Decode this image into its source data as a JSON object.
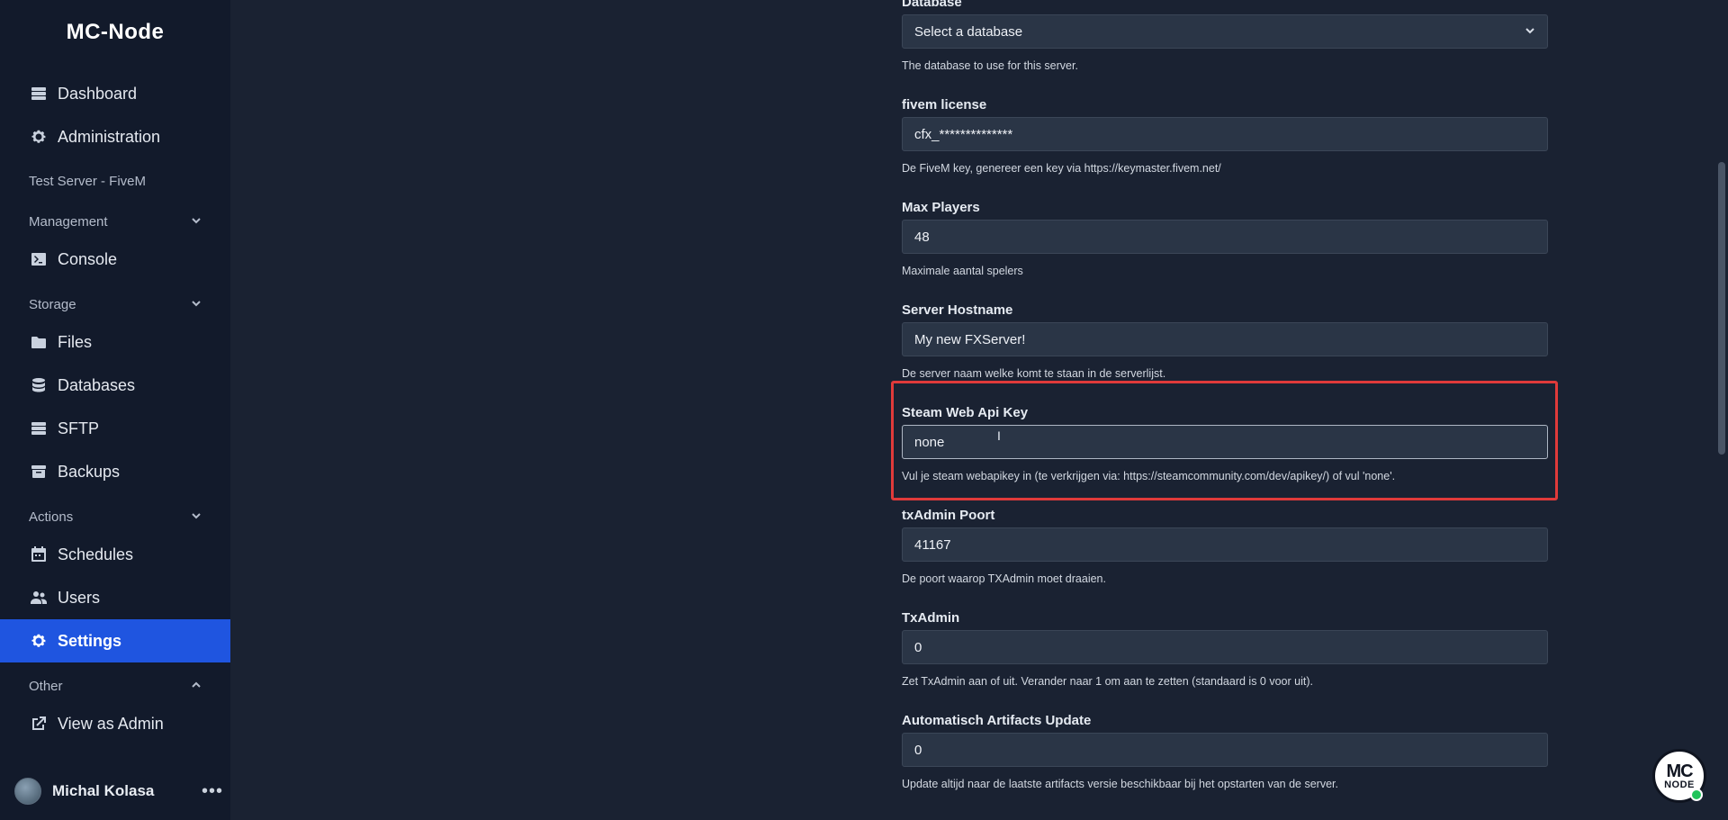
{
  "app": {
    "brand": "MC-Node"
  },
  "sidebar": {
    "top_items": [
      {
        "label": "Dashboard",
        "icon": "server-stack-icon"
      },
      {
        "label": "Administration",
        "icon": "gear-icon"
      }
    ],
    "server_name": "Test Server - FiveM",
    "sections": {
      "management": {
        "label": "Management"
      },
      "storage": {
        "label": "Storage"
      },
      "actions": {
        "label": "Actions"
      },
      "other": {
        "label": "Other"
      }
    },
    "items": {
      "console": {
        "label": "Console",
        "icon": "terminal-icon"
      },
      "files": {
        "label": "Files",
        "icon": "folder-icon"
      },
      "databases": {
        "label": "Databases",
        "icon": "database-icon"
      },
      "sftp": {
        "label": "SFTP",
        "icon": "server-stack-icon"
      },
      "backups": {
        "label": "Backups",
        "icon": "archive-box-icon"
      },
      "schedules": {
        "label": "Schedules",
        "icon": "calendar-icon"
      },
      "users": {
        "label": "Users",
        "icon": "users-icon"
      },
      "settings": {
        "label": "Settings",
        "icon": "gear-icon"
      },
      "view_as_admin": {
        "label": "View as Admin",
        "icon": "external-link-icon"
      }
    },
    "user": {
      "name": "Michal Kolasa"
    }
  },
  "form": {
    "database": {
      "label": "Database",
      "value": "Select a database",
      "hint": "The database to use for this server."
    },
    "fivem_license": {
      "label": "fivem license",
      "value": "cfx_**************",
      "hint": "De FiveM key, genereer een key via https://keymaster.fivem.net/"
    },
    "max_players": {
      "label": "Max Players",
      "value": "48",
      "hint": "Maximale aantal spelers"
    },
    "server_hostname": {
      "label": "Server Hostname",
      "value": "My new FXServer!",
      "hint": "De server naam welke komt te staan in de serverlijst."
    },
    "steam_api_key": {
      "label": "Steam Web Api Key",
      "value": "none",
      "hint": "Vul je steam webapikey in (te verkrijgen via: https://steamcommunity.com/dev/apikey/) of vul 'none'."
    },
    "txadmin_port": {
      "label": "txAdmin Poort",
      "value": "41167",
      "hint": "De poort waarop TXAdmin moet draaien."
    },
    "txadmin": {
      "label": "TxAdmin",
      "value": "0",
      "hint": "Zet TxAdmin aan of uit. Verander naar 1 om aan te zetten (standaard is 0 voor uit)."
    },
    "auto_artifacts": {
      "label": "Automatisch Artifacts Update",
      "value": "0",
      "hint": "Update altijd naar de laatste artifacts versie beschikbaar bij het opstarten van de server."
    }
  },
  "fab": {
    "line1": "MC",
    "line2": "NODE"
  },
  "colors": {
    "accent": "#1f55e0",
    "highlight": "#e03a3a",
    "status_online": "#21c45a"
  }
}
